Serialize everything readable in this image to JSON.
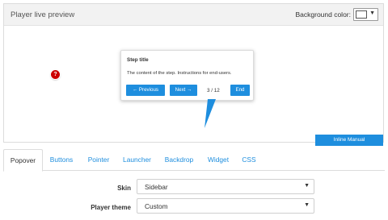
{
  "preview": {
    "title": "Player live preview",
    "background_color_label": "Background color:",
    "background_color_value": "#ffffff",
    "help_marker_glyph": "?"
  },
  "popover": {
    "title": "Step title",
    "content": "The content of the step. Instructions for end-users.",
    "prev_label": "← Previous",
    "next_label": "Next →",
    "counter": "3 / 12",
    "end_label": "End"
  },
  "inline_manual_label": "Inline Manual",
  "tabs": [
    "Popover",
    "Buttons",
    "Pointer",
    "Launcher",
    "Backdrop",
    "Widget",
    "CSS"
  ],
  "active_tab": "Popover",
  "form": {
    "skin_label": "Skin",
    "skin_value": "Sidebar",
    "theme_label": "Player theme",
    "theme_value": "Custom"
  },
  "colors": {
    "accent": "#1e8ede",
    "marker": "#cc0000",
    "panel_header": "#f2f2f2"
  }
}
